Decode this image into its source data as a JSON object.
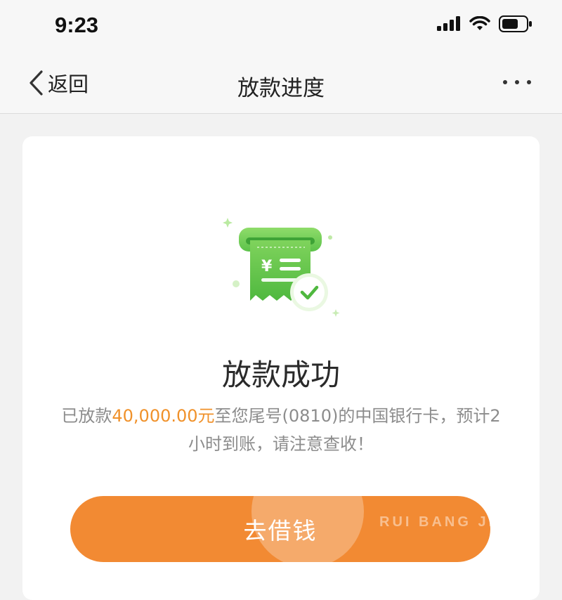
{
  "status_bar": {
    "time": "9:23",
    "icons": [
      "signal-icon",
      "wifi-icon",
      "battery-icon"
    ]
  },
  "nav": {
    "back_label": "返回",
    "title": "放款进度",
    "more_icon": "more-dots-icon"
  },
  "result": {
    "illustration_icon": "receipt-check-icon",
    "title": "放款成功",
    "desc_prefix": "已放款",
    "amount": "40,000.00元",
    "desc_suffix": "至您尾号(0810)的中国银行卡，预计2小时到账，请注意查收！"
  },
  "cta": {
    "label": "去借钱"
  },
  "watermark": {
    "text": "RUI BANG JI"
  },
  "colors": {
    "accent": "#f28a33",
    "amount": "#f0912a",
    "success_green": "#5cc24a"
  }
}
